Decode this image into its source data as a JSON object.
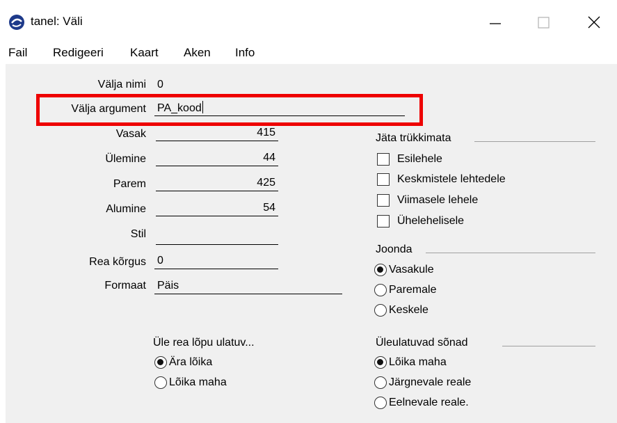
{
  "window": {
    "title": "tanel: Väli"
  },
  "menu": [
    "Fail",
    "Redigeeri",
    "Kaart",
    "Aken",
    "Info"
  ],
  "form": {
    "valja_nimi": {
      "label": "Välja nimi",
      "value": "0"
    },
    "valja_argument": {
      "label": "Välja argument",
      "value": "PA_kood"
    },
    "vasak": {
      "label": "Vasak",
      "value": "415"
    },
    "ulemine": {
      "label": "Ülemine",
      "value": "44"
    },
    "parem": {
      "label": "Parem",
      "value": "425"
    },
    "alumine": {
      "label": "Alumine",
      "value": "54"
    },
    "stil": {
      "label": "Stil",
      "value": ""
    },
    "rea_korgus": {
      "label": "Rea kõrgus",
      "value": "0"
    },
    "formaat": {
      "label": "Formaat",
      "value": "Päis"
    }
  },
  "jata_trukkimata": {
    "title": "Jäta trükkimata",
    "options": [
      {
        "label": "Esilehele",
        "checked": false
      },
      {
        "label": "Keskmistele lehtedele",
        "checked": false
      },
      {
        "label": "Viimasele lehele",
        "checked": false
      },
      {
        "label": "Ühelehelisele",
        "checked": false
      }
    ]
  },
  "joonda": {
    "title": "Joonda",
    "selected": "Vasakule",
    "options": [
      "Vasakule",
      "Paremale",
      "Keskele"
    ]
  },
  "ule_rea": {
    "title": "Üle rea lõpu ulatuv...",
    "selected": "Ära lõika",
    "options": [
      "Ära lõika",
      "Lõika maha"
    ]
  },
  "uleulatuvad": {
    "title": "Üleulatuvad sõnad",
    "selected": "Lõika maha",
    "options": [
      "Lõika maha",
      "Järgnevale reale",
      "Eelnevale reale."
    ]
  },
  "colors": {
    "highlight": "#ee0000",
    "content_bg": "#f0f0f0"
  }
}
